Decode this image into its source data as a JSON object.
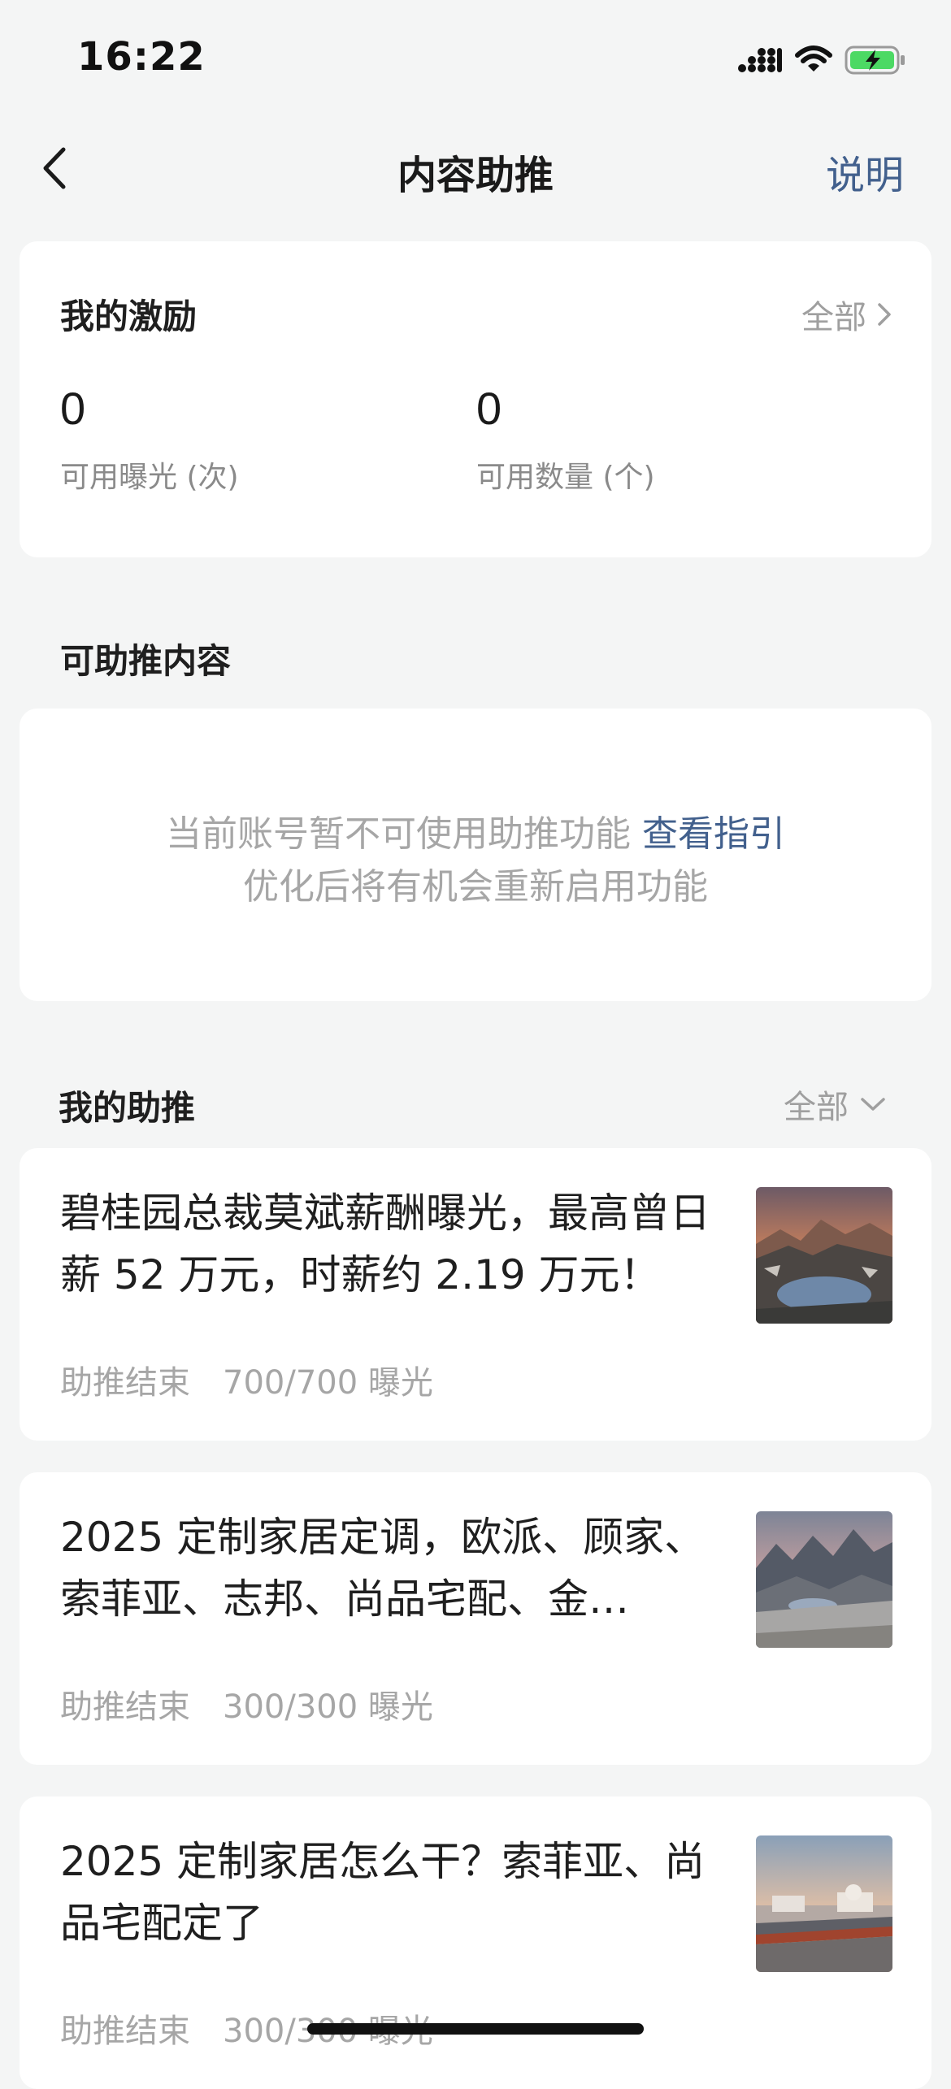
{
  "status_bar": {
    "time": "16:22"
  },
  "nav": {
    "title": "内容助推",
    "help": "说明"
  },
  "incentives": {
    "title": "我的激励",
    "all": "全部",
    "stats": [
      {
        "value": "0",
        "label": "可用曝光 (次)"
      },
      {
        "value": "0",
        "label": "可用数量 (个)"
      }
    ]
  },
  "eligible": {
    "title": "可助推内容",
    "message": "当前账号暂不可使用助推功能",
    "guide_link": "查看指引",
    "message2": "优化后将有机会重新启用功能"
  },
  "my_boosts": {
    "title": "我的助推",
    "filter": "全部",
    "items": [
      {
        "title": "碧桂园总裁莫斌薪酬曝光，最高曾日薪 52 万元，时薪约 2.19 万元！",
        "status": "助推结束",
        "exposure": "700/700 曝光",
        "thumb": "sunset-mountain-lake"
      },
      {
        "title": "2025 定制家居定调，欧派、顾家、索菲亚、志邦、尚品宅配、金…",
        "status": "助推结束",
        "exposure": "300/300 曝光",
        "thumb": "alpine-lake"
      },
      {
        "title": "2025 定制家居怎么干？索菲亚、尚品宅配定了",
        "status": "助推结束",
        "exposure": "300/300 曝光",
        "thumb": "harbor-sunset"
      }
    ]
  },
  "colors": {
    "accent": "#42608d",
    "background": "#f4f5f5",
    "card": "#ffffff"
  }
}
